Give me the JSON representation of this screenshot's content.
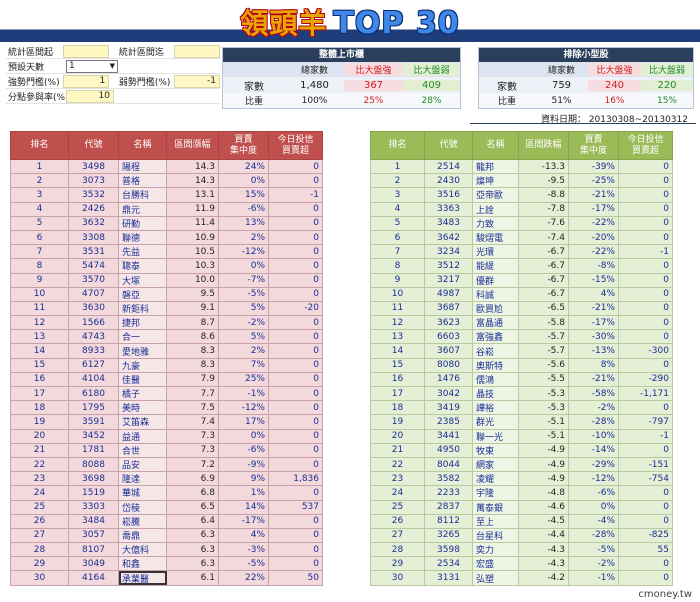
{
  "banner": {
    "title_cn": "領頭羊",
    "title_en": "TOP 30"
  },
  "settings": {
    "period_start_label": "統計區間起",
    "period_start_value": "",
    "period_end_label": "統計區間迄",
    "period_end_value": "",
    "default_days_label": "預設天數",
    "default_days_value": "1",
    "strong_threshold_label": "強勢門檻(%)",
    "strong_threshold_value": "1",
    "weak_threshold_label": "弱勢門檻(%)",
    "weak_threshold_value": "-1",
    "score_rate_label": "分點參與率(%)",
    "score_rate_value": "10"
  },
  "panel_all": {
    "title": "整體上市櫃",
    "headers": [
      "總家數",
      "比大盤強",
      "比大盤弱"
    ],
    "count_label": "家數",
    "counts": [
      "1,480",
      "367",
      "409"
    ],
    "ratio_label": "比重",
    "ratios": [
      "100%",
      "25%",
      "28%"
    ]
  },
  "panel_excl": {
    "title": "排除小型股",
    "headers": [
      "總家數",
      "比大盤強",
      "比大盤弱"
    ],
    "count_label": "家數",
    "counts": [
      "759",
      "240",
      "220"
    ],
    "ratio_label": "比重",
    "ratios": [
      "51%",
      "16%",
      "15%"
    ]
  },
  "date_line": "資料日期： 20130308~20130312",
  "left_table": {
    "headers": [
      "排名",
      "代號",
      "名稱",
      "區間漲幅",
      "買賣\n集中度",
      "今日投信\n買賣超"
    ],
    "rows": [
      [
        "1",
        "3498",
        "陽程",
        "14.3",
        "24%",
        "0"
      ],
      [
        "2",
        "3073",
        "普格",
        "14.3",
        "0%",
        "0"
      ],
      [
        "3",
        "3532",
        "台勝科",
        "13.1",
        "15%",
        "-1"
      ],
      [
        "4",
        "2426",
        "鼎元",
        "11.9",
        "-6%",
        "0"
      ],
      [
        "5",
        "3632",
        "研勤",
        "11.4",
        "13%",
        "0"
      ],
      [
        "6",
        "3308",
        "聯德",
        "10.9",
        "2%",
        "0"
      ],
      [
        "7",
        "3531",
        "先益",
        "10.5",
        "-12%",
        "0"
      ],
      [
        "8",
        "5474",
        "聰泰",
        "10.3",
        "0%",
        "0"
      ],
      [
        "9",
        "3570",
        "大塚",
        "10.0",
        "-7%",
        "0"
      ],
      [
        "10",
        "4707",
        "磐亞",
        "9.5",
        "-5%",
        "0"
      ],
      [
        "11",
        "3630",
        "新鉅科",
        "9.1",
        "5%",
        "-20"
      ],
      [
        "12",
        "1566",
        "捷邦",
        "8.7",
        "-2%",
        "0"
      ],
      [
        "13",
        "4743",
        "合一",
        "8.6",
        "5%",
        "0"
      ],
      [
        "14",
        "8933",
        "愛地雅",
        "8.3",
        "2%",
        "0"
      ],
      [
        "15",
        "6127",
        "九豪",
        "8.3",
        "7%",
        "0"
      ],
      [
        "16",
        "4104",
        "佳醫",
        "7.9",
        "25%",
        "0"
      ],
      [
        "17",
        "6180",
        "橘子",
        "7.7",
        "-1%",
        "0"
      ],
      [
        "18",
        "1795",
        "美時",
        "7.5",
        "-12%",
        "0"
      ],
      [
        "19",
        "3591",
        "艾笛森",
        "7.4",
        "17%",
        "0"
      ],
      [
        "20",
        "3452",
        "益通",
        "7.3",
        "0%",
        "0"
      ],
      [
        "21",
        "1781",
        "合世",
        "7.3",
        "-6%",
        "0"
      ],
      [
        "22",
        "8088",
        "品安",
        "7.2",
        "-9%",
        "0"
      ],
      [
        "23",
        "3698",
        "隆達",
        "6.9",
        "9%",
        "1,836"
      ],
      [
        "24",
        "1519",
        "華城",
        "6.8",
        "1%",
        "0"
      ],
      [
        "25",
        "3303",
        "岱稜",
        "6.5",
        "14%",
        "537"
      ],
      [
        "26",
        "3484",
        "崧騰",
        "6.4",
        "-17%",
        "0"
      ],
      [
        "27",
        "3057",
        "喬鼎",
        "6.3",
        "4%",
        "0"
      ],
      [
        "28",
        "8107",
        "大億科",
        "6.3",
        "-3%",
        "0"
      ],
      [
        "29",
        "3049",
        "和鑫",
        "6.3",
        "-5%",
        "0"
      ],
      [
        "30",
        "4164",
        "承業醫",
        "6.1",
        "22%",
        "50"
      ]
    ]
  },
  "right_table": {
    "headers": [
      "排名",
      "代號",
      "名稱",
      "區間跌幅",
      "買賣\n集中度",
      "今日投信\n買賣超"
    ],
    "rows": [
      [
        "1",
        "2514",
        "龍邦",
        "-13.3",
        "-39%",
        "0"
      ],
      [
        "2",
        "2430",
        "燦坤",
        "-9.5",
        "-25%",
        "0"
      ],
      [
        "3",
        "3516",
        "亞帝歐",
        "-8.8",
        "-21%",
        "0"
      ],
      [
        "4",
        "3363",
        "上詮",
        "-7.8",
        "-17%",
        "0"
      ],
      [
        "5",
        "3483",
        "力致",
        "-7.6",
        "-22%",
        "0"
      ],
      [
        "6",
        "3642",
        "駿熠電",
        "-7.4",
        "-20%",
        "0"
      ],
      [
        "7",
        "3234",
        "光環",
        "-6.7",
        "-22%",
        "-1"
      ],
      [
        "8",
        "3512",
        "能緹",
        "-6.7",
        "-8%",
        "0"
      ],
      [
        "9",
        "3217",
        "優群",
        "-6.7",
        "-15%",
        "0"
      ],
      [
        "10",
        "4987",
        "科誠",
        "-6.7",
        "4%",
        "0"
      ],
      [
        "11",
        "3687",
        "歐買尬",
        "-6.5",
        "-21%",
        "0"
      ],
      [
        "12",
        "3623",
        "富晶通",
        "-5.8",
        "-17%",
        "0"
      ],
      [
        "13",
        "6603",
        "富強鑫",
        "-5.7",
        "-30%",
        "0"
      ],
      [
        "14",
        "3607",
        "谷崧",
        "-5.7",
        "-13%",
        "-300"
      ],
      [
        "15",
        "8080",
        "奧斯特",
        "-5.6",
        "8%",
        "0"
      ],
      [
        "16",
        "1476",
        "儒鴻",
        "-5.5",
        "-21%",
        "-290"
      ],
      [
        "17",
        "3042",
        "晶技",
        "-5.3",
        "-58%",
        "-1,171"
      ],
      [
        "18",
        "3419",
        "譁裕",
        "-5.3",
        "-2%",
        "0"
      ],
      [
        "19",
        "2385",
        "群光",
        "-5.1",
        "-28%",
        "-797"
      ],
      [
        "20",
        "3441",
        "聯一光",
        "-5.1",
        "-10%",
        "-1"
      ],
      [
        "21",
        "4950",
        "牧東",
        "-4.9",
        "-14%",
        "0"
      ],
      [
        "22",
        "8044",
        "網家",
        "-4.9",
        "-29%",
        "-151"
      ],
      [
        "23",
        "3582",
        "凌耀",
        "-4.9",
        "-12%",
        "-754"
      ],
      [
        "24",
        "2233",
        "宇隆",
        "-4.8",
        "-6%",
        "0"
      ],
      [
        "25",
        "2837",
        "萬泰銀",
        "-4.6",
        "0%",
        "0"
      ],
      [
        "26",
        "8112",
        "至上",
        "-4.5",
        "-4%",
        "0"
      ],
      [
        "27",
        "3265",
        "台星科",
        "-4.4",
        "-28%",
        "-825"
      ],
      [
        "28",
        "3598",
        "奕力",
        "-4.3",
        "-5%",
        "55"
      ],
      [
        "29",
        "2534",
        "宏盛",
        "-4.3",
        "-2%",
        "0"
      ],
      [
        "30",
        "3131",
        "弘塑",
        "-4.2",
        "-1%",
        "0"
      ]
    ]
  },
  "watermark": "cmoney.tw"
}
